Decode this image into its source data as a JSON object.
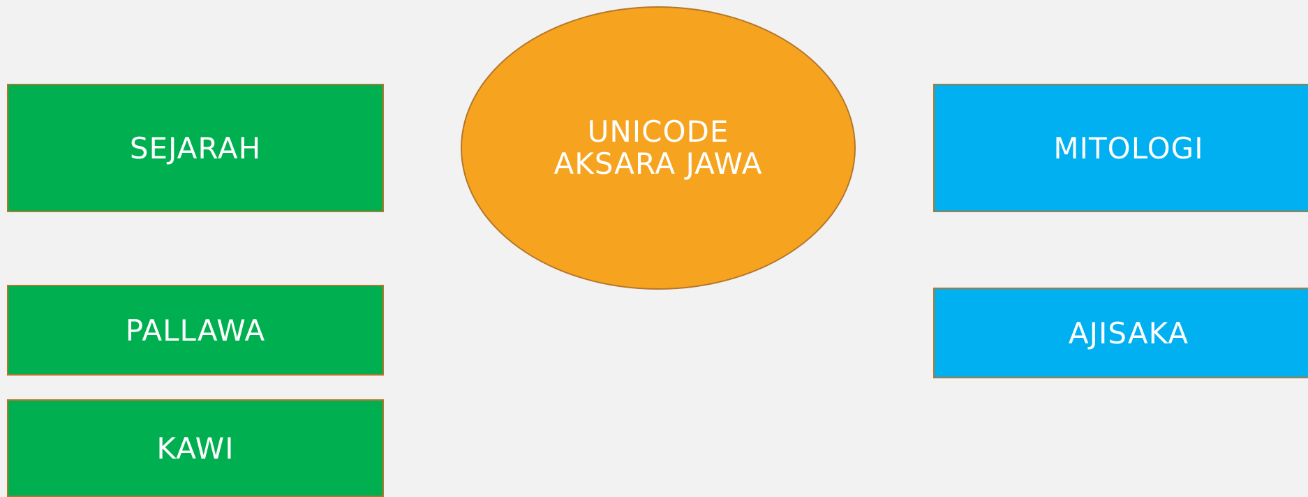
{
  "diagram": {
    "center": {
      "line1": "UNICODE",
      "line2": "AKSARA JAWA",
      "color": "#f6a31f"
    },
    "left": {
      "color": "#00b050",
      "items": [
        {
          "label": "SEJARAH"
        },
        {
          "label": "PALLAWA"
        },
        {
          "label": "KAWI"
        }
      ]
    },
    "right": {
      "color": "#00b0f0",
      "items": [
        {
          "label": "MITOLOGI"
        },
        {
          "label": "AJISAKA"
        }
      ]
    },
    "background": "#f2f2f2"
  }
}
